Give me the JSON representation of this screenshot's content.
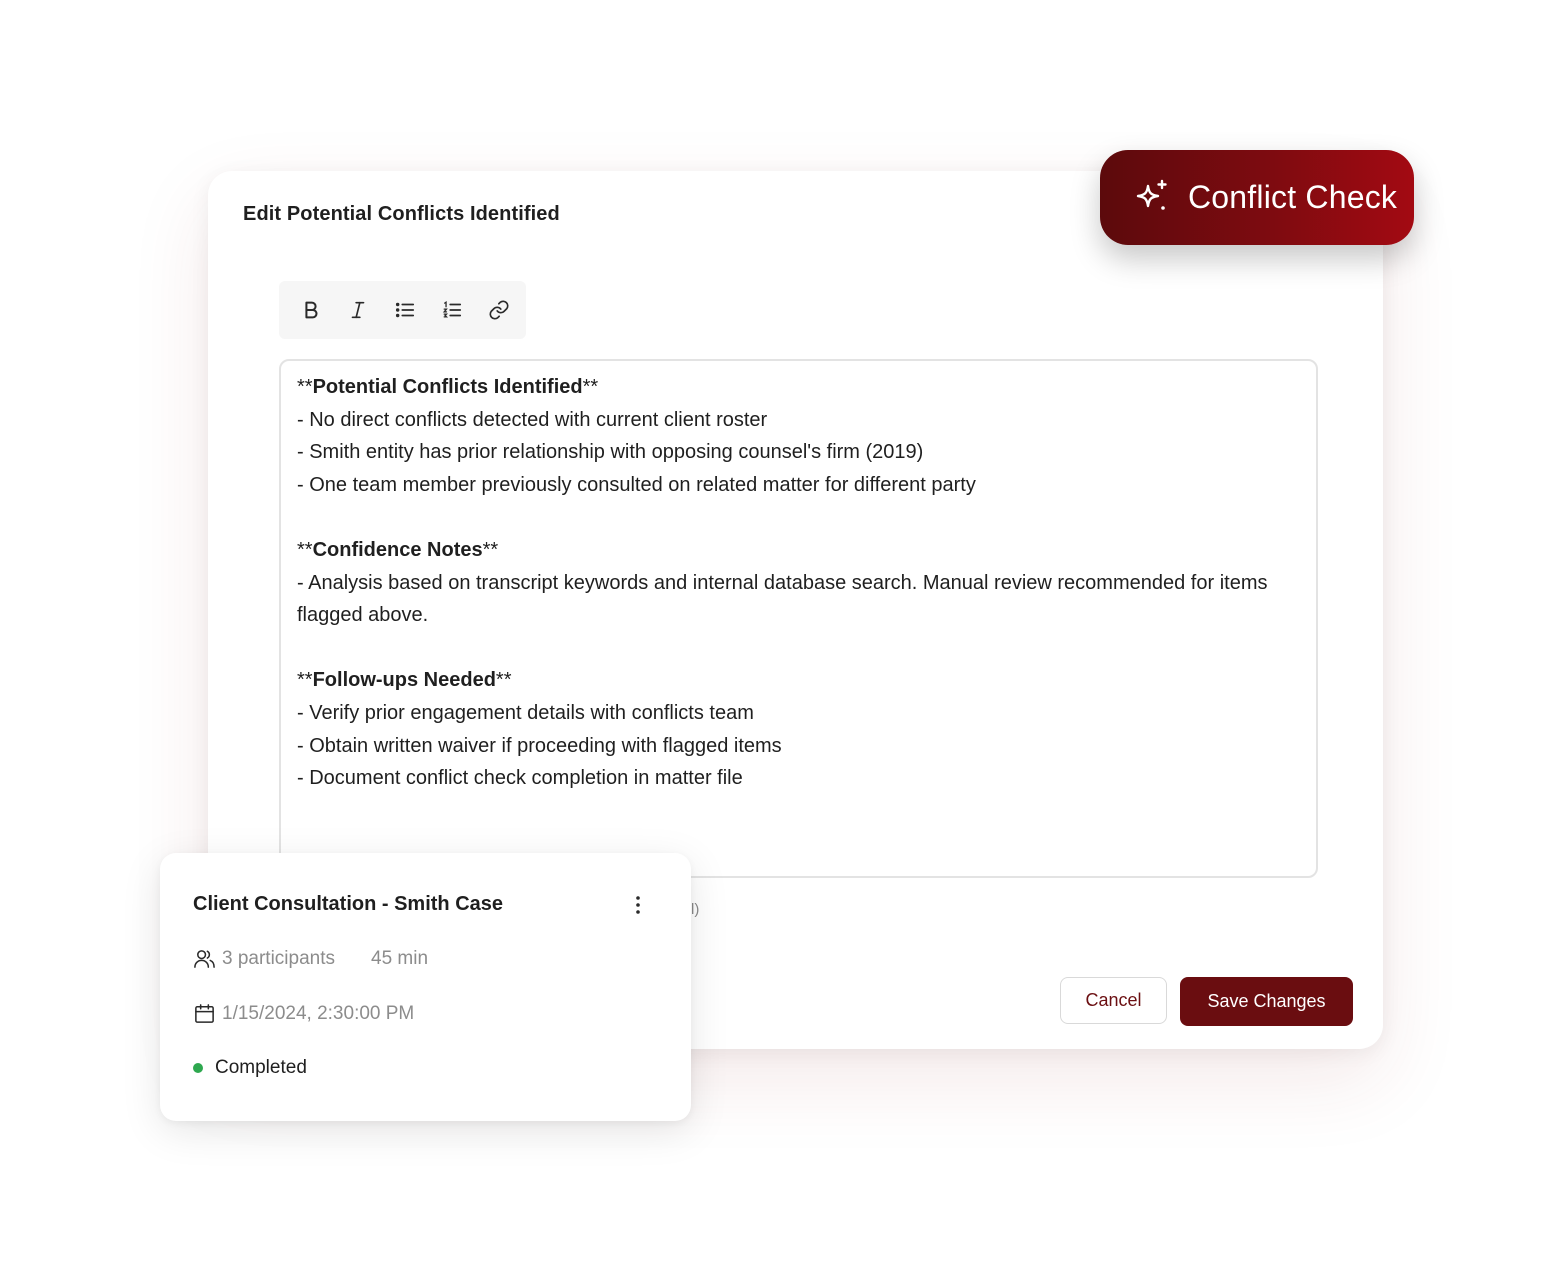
{
  "dialog": {
    "title": "Edit Potential Conflicts Identified",
    "toolbar": {
      "bold_icon": "bold-icon",
      "italic_icon": "italic-icon",
      "bullet_list_icon": "bulleted-list-icon",
      "numbered_list_icon": "numbered-list-icon",
      "link_icon": "link-icon"
    },
    "editor": {
      "section1_prefix": "**",
      "section1_heading": "Potential Conflicts Identified",
      "section1_suffix": "**",
      "section1_lines": [
        "- No direct conflicts detected with current client roster",
        "- Smith entity has prior relationship with opposing counsel's firm (2019)",
        "- One team member previously consulted on related matter for different party"
      ],
      "section2_prefix": "**",
      "section2_heading": "Confidence Notes",
      "section2_suffix": "**",
      "section2_lines": [
        "- Analysis based on transcript keywords and internal database search. Manual review recommended for items flagged above."
      ],
      "section3_prefix": "**",
      "section3_heading": "Follow-ups Needed",
      "section3_suffix": "**",
      "section3_lines": [
        "- Verify prior engagement details with conflicts team",
        "- Obtain written waiver if proceeding with flagged items",
        "- Document conflict check completion in matter file"
      ]
    },
    "hint_text": "rl)",
    "cancel_label": "Cancel",
    "save_label": "Save Changes"
  },
  "badge": {
    "label": "Conflict Check",
    "icon": "sparkle-icon"
  },
  "card": {
    "title": "Client Consultation - Smith Case",
    "participants": "3 participants",
    "duration": "45 min",
    "datetime": "1/15/2024, 2:30:00 PM",
    "status": "Completed",
    "status_color": "#2ea84f"
  },
  "colors": {
    "accent": "#6a0d10",
    "badge_gradient_start": "#5c0a0c",
    "badge_gradient_end": "#a30a12"
  }
}
